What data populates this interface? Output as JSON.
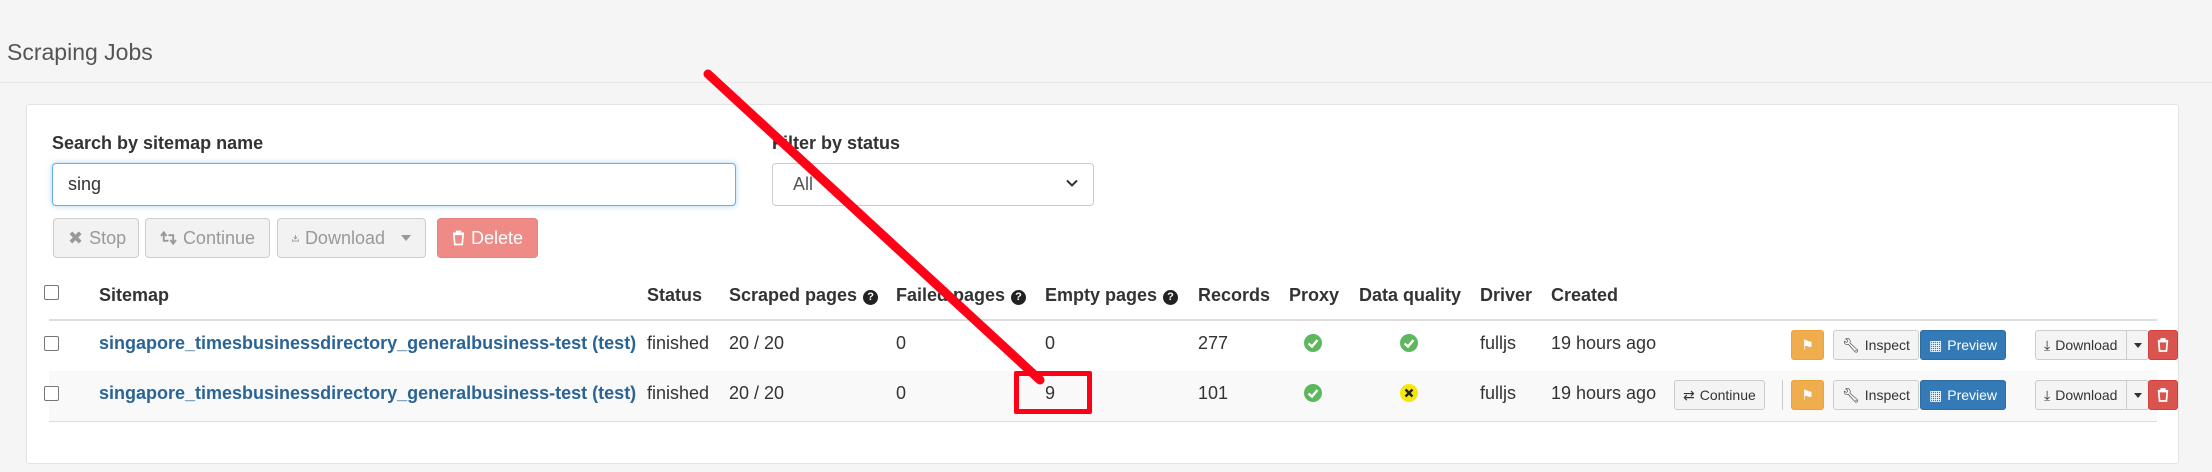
{
  "page": {
    "title": "Scraping Jobs"
  },
  "filters": {
    "search_label": "Search by sitemap name",
    "search_value": "sing",
    "status_label": "Filter by status",
    "status_value": "All"
  },
  "toolbar": {
    "stop": "Stop",
    "continue": "Continue",
    "download": "Download",
    "delete": "Delete"
  },
  "table": {
    "headers": {
      "sitemap": "Sitemap",
      "status": "Status",
      "scraped": "Scraped pages",
      "failed": "Failed pages",
      "empty": "Empty pages",
      "records": "Records",
      "proxy": "Proxy",
      "quality": "Data quality",
      "driver": "Driver",
      "created": "Created"
    },
    "rows": [
      {
        "sitemap": "singapore_timesbusinessdirectory_generalbusiness-test (test)",
        "status": "finished",
        "scraped": "20 / 20",
        "failed": "0",
        "empty": "0",
        "records": "277",
        "proxy": "ok",
        "quality": "ok",
        "driver": "fulljs",
        "created": "19 hours ago"
      },
      {
        "sitemap": "singapore_timesbusinessdirectory_generalbusiness-test (test)",
        "status": "finished",
        "scraped": "20 / 20",
        "failed": "0",
        "empty": "9",
        "records": "101",
        "proxy": "ok",
        "quality": "warning",
        "driver": "fulljs",
        "created": "19 hours ago",
        "continue": "Continue"
      }
    ],
    "row_actions": {
      "inspect": "Inspect",
      "preview": "Preview",
      "download": "Download"
    }
  },
  "colors": {
    "link": "#2a6496",
    "success": "#5cb85c",
    "warning_icon": "#f5e70b",
    "annotation": "#ff0017",
    "primary": "#337ab7",
    "danger": "#d9534f",
    "flag": "#f0ad4e"
  },
  "icons": [
    "times-icon",
    "retweet-icon",
    "download-icon",
    "trash-icon",
    "question-icon",
    "check-circle-icon",
    "warning-circle-icon",
    "flag-icon",
    "wrench-icon",
    "table-icon",
    "chevron-down-icon"
  ]
}
